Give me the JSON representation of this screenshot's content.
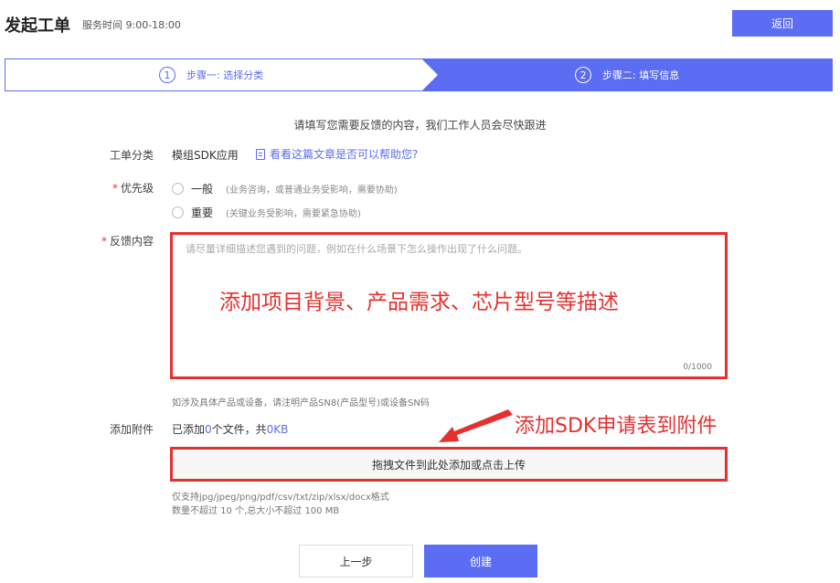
{
  "header": {
    "title": "发起工单",
    "service_time": "服务时间  9:00-18:00",
    "back_label": "返回"
  },
  "steps": [
    {
      "number": "1",
      "label": "步骤一: 选择分类"
    },
    {
      "number": "2",
      "label": "步骤二: 填写信息"
    }
  ],
  "intro": "请填写您需要反馈的内容，我们工作人员会尽快跟进",
  "form": {
    "category": {
      "label": "工单分类",
      "value": "模组SDK应用",
      "help_link": "看看这篇文章是否可以帮助您?"
    },
    "priority": {
      "required_mark": "*",
      "label": "优先级",
      "options": [
        {
          "label": "一般",
          "desc": "(业务咨询，或普通业务受影响，需要协助)"
        },
        {
          "label": "重要",
          "desc": "(关键业务受影响，需要紧急协助)"
        }
      ]
    },
    "feedback": {
      "required_mark": "*",
      "label": "反馈内容",
      "placeholder": "请尽量详细描述您遇到的问题，例如在什么场景下怎么操作出现了什么问题。",
      "counter": "0/1000",
      "hint": "如涉及具体产品或设备，请注明产品SN8(产品型号)或设备SN码"
    },
    "attachment": {
      "label": "添加附件",
      "prefix": "已添加",
      "count": "0",
      "middle": "个文件，共",
      "size": "0KB",
      "upload_label": "拖拽文件到此处添加或点击上传",
      "formats": "仅支持jpg/jpeg/png/pdf/csv/txt/zip/xlsx/docx格式",
      "limits": "数量不超过 10 个,总大小不超过 100 MB"
    }
  },
  "annotations": {
    "feedback_note": "添加项目背景、产品需求、芯片型号等描述",
    "attachment_note": "添加SDK申请表到附件"
  },
  "buttons": {
    "prev": "上一步",
    "create": "创建"
  },
  "colors": {
    "primary": "#5b6df2",
    "annotation_red": "#e53030",
    "required_red": "#e23b3b"
  }
}
